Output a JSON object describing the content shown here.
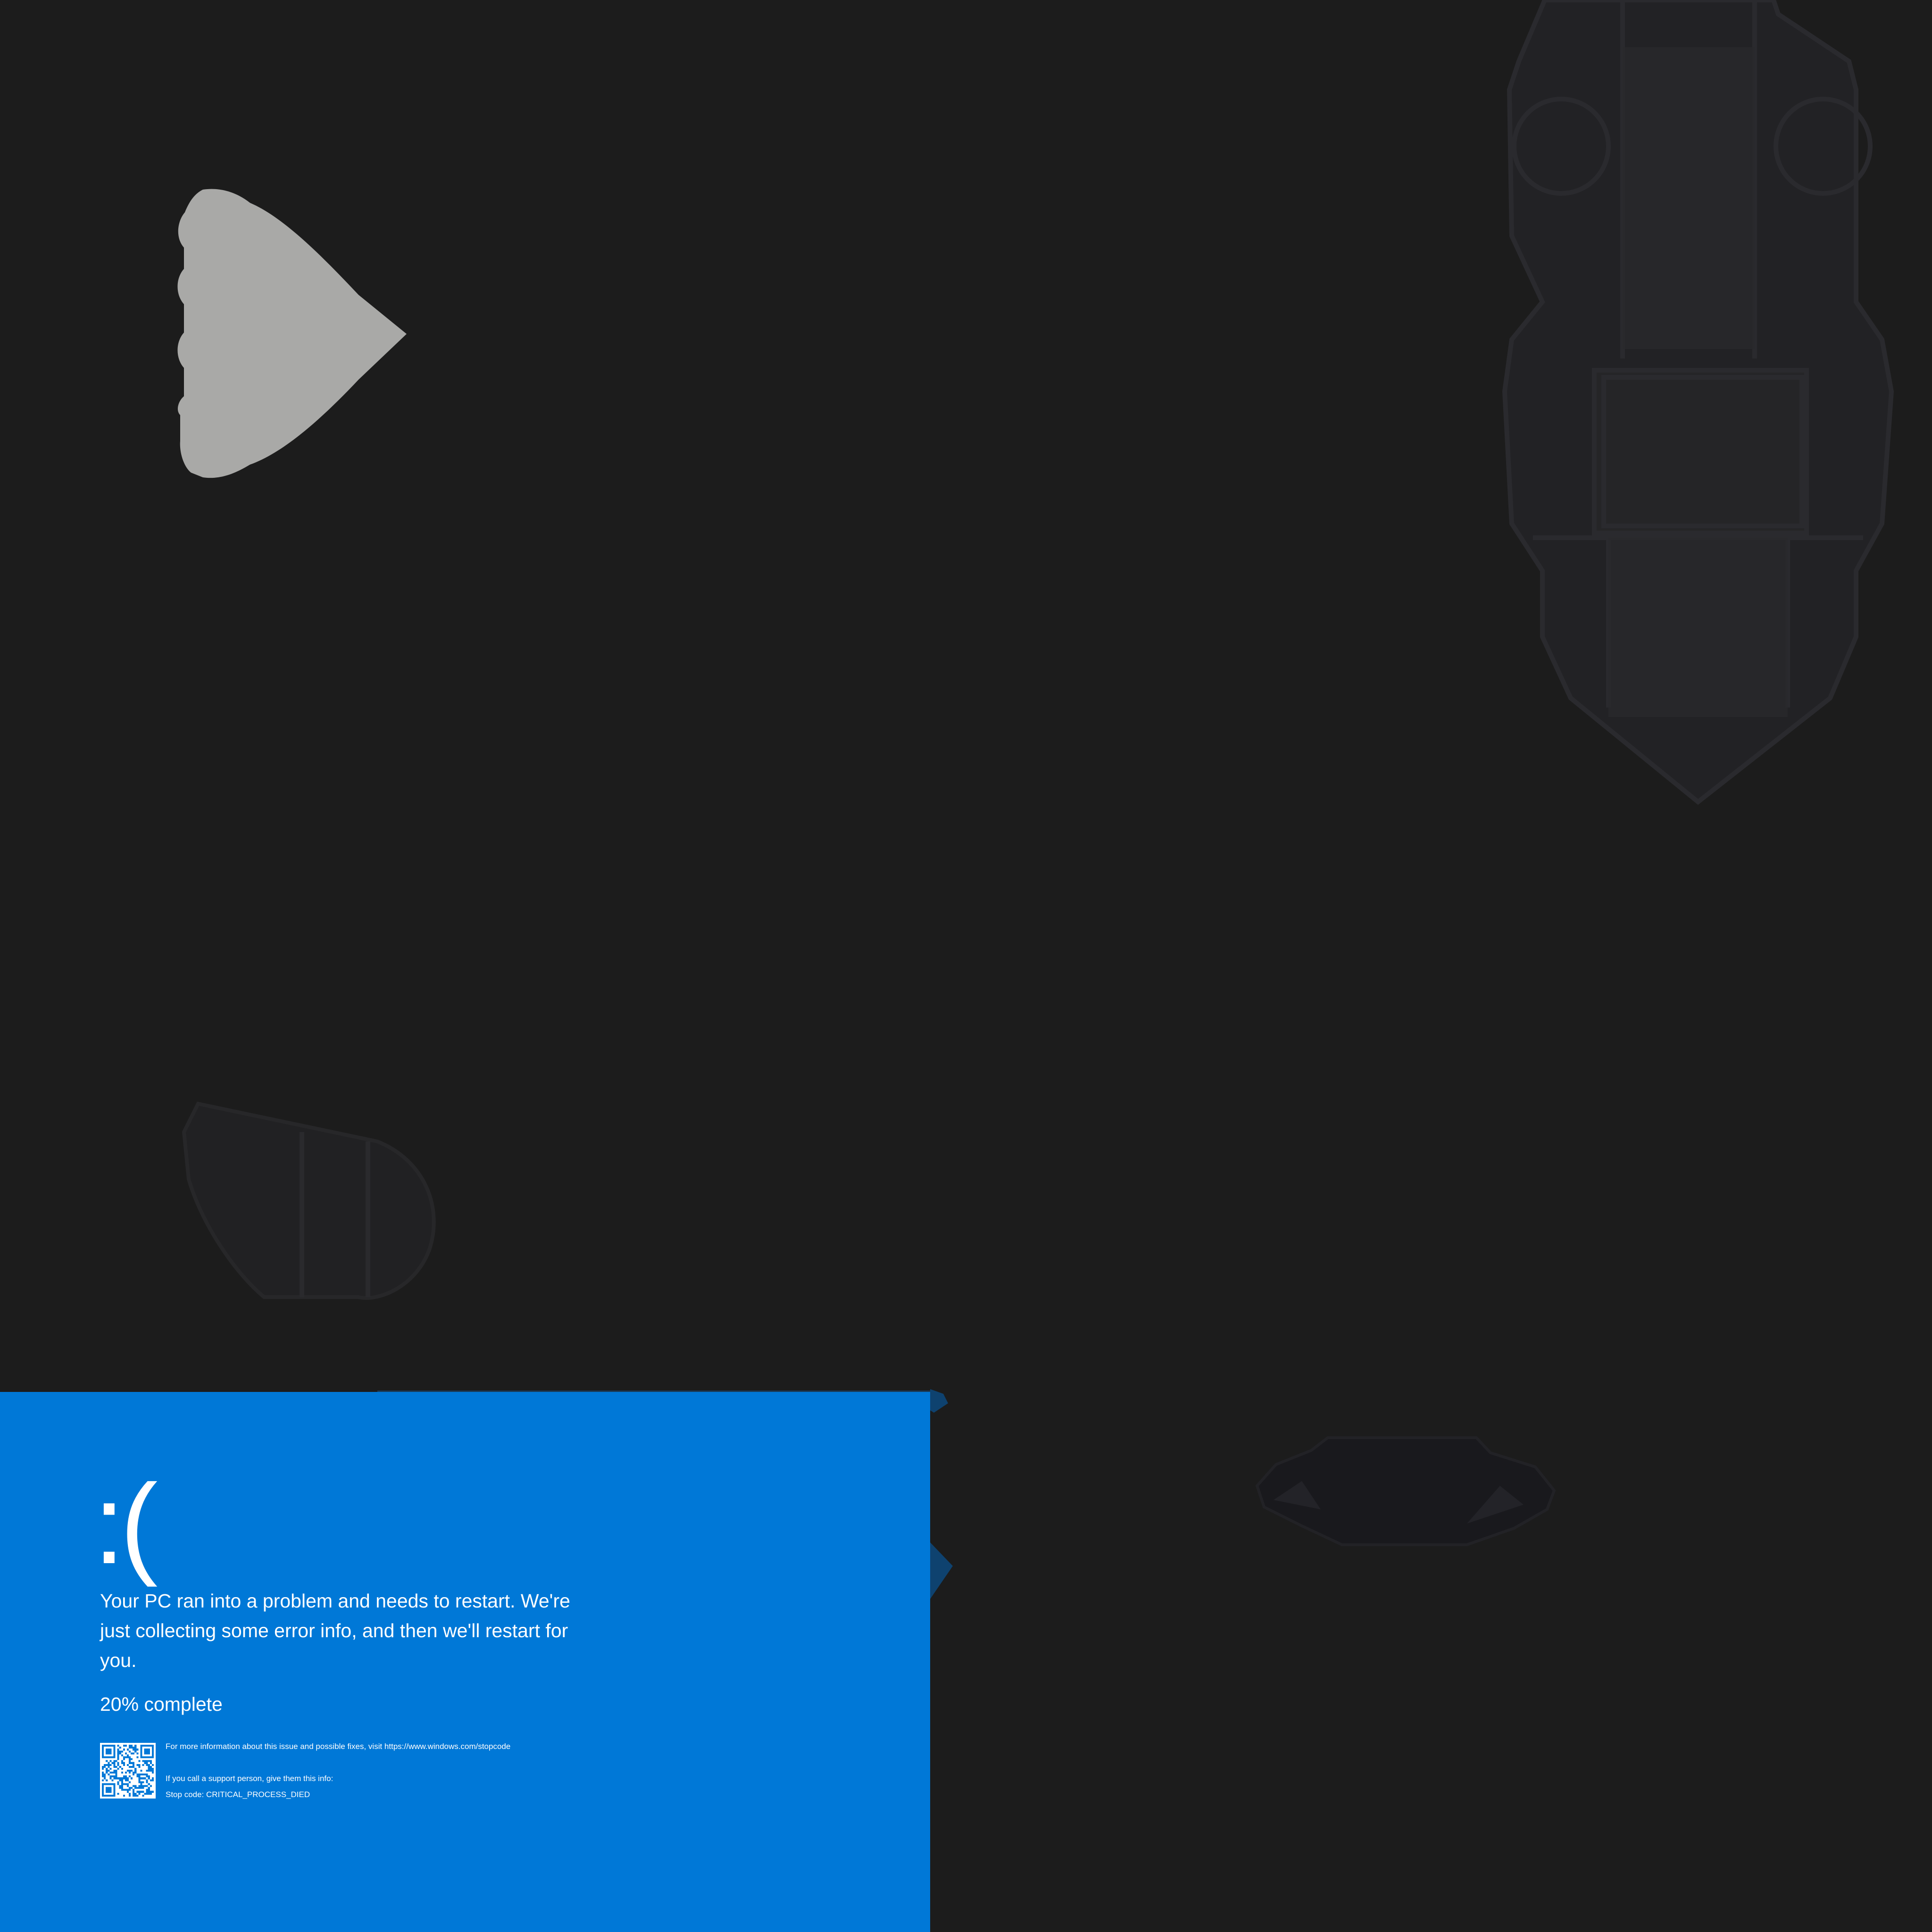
{
  "bsod": {
    "frown": ":(",
    "message": "Your PC ran into a problem and needs to restart. We're just collecting some error info, and then we'll restart for you.",
    "progress_percent": 20,
    "progress_text": "20% complete",
    "more_info": "For more information about this issue and possible fixes, visit https://www.windows.com/stopcode",
    "support_text": "If you call a support person, give them this info:",
    "stop_code": "Stop code: CRITICAL_PROCESS_DIED"
  },
  "colors": {
    "background": "#1c1c1c",
    "bsod_blue": "#0078d7",
    "text": "#ffffff",
    "heart_gray": "#a9a9a7",
    "faint_shape": "#262629"
  }
}
